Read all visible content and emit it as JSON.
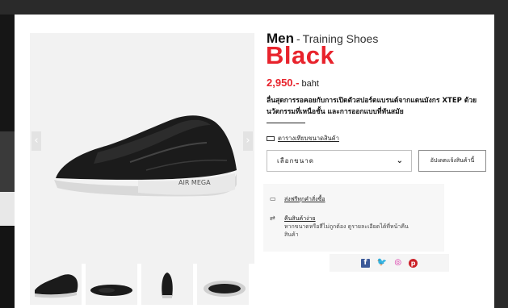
{
  "product": {
    "gender": "Men",
    "separator": "-",
    "category": "Training Shoes",
    "color": "Black",
    "price": "2,950.-",
    "currency": "baht",
    "description": "ลื่นสุดการรอคอยกับการเปิดตัวสปอร์ตแบรนด์จากแดนมังกร XTEP ด้วยนวัตกรรมที่เหนือชั้น และการออกแบบที่ทันสมัย"
  },
  "gallery": {
    "prev_icon": "‹",
    "next_icon": "›",
    "shoe_text": "AIR MEGA",
    "thumbnails": [
      "side-view",
      "sole-view",
      "back-view",
      "bottom-view"
    ]
  },
  "size_guide": {
    "label": "ตารางเทียบขนาดสินค้า",
    "icon": "ruler-icon"
  },
  "size_select": {
    "value": "เลือกขนาด",
    "chevron": "⌄"
  },
  "notify_button": {
    "label": "อัปเดตแจ้งสินค้านี้"
  },
  "perks": {
    "shipping": {
      "label": "ส่งฟรีทุกคำสั่งซื้อ",
      "icon": "truck-icon"
    },
    "returns": {
      "label": "คืนสินค้าง่าย",
      "note": "หากขนาดหรือสีไม่ถูกต้อง ดูรายละเอียดได้ที่หน้าคืนสินค้า",
      "icon": "return-icon"
    }
  },
  "social": {
    "facebook": "f",
    "twitter": "🐦",
    "instagram": "◎",
    "pinterest": "p"
  },
  "colors": {
    "accent": "#e8232c",
    "facebook": "#3b5998",
    "twitter": "#1da1f2",
    "instagram": "#d6249f",
    "pinterest": "#cb2027"
  }
}
